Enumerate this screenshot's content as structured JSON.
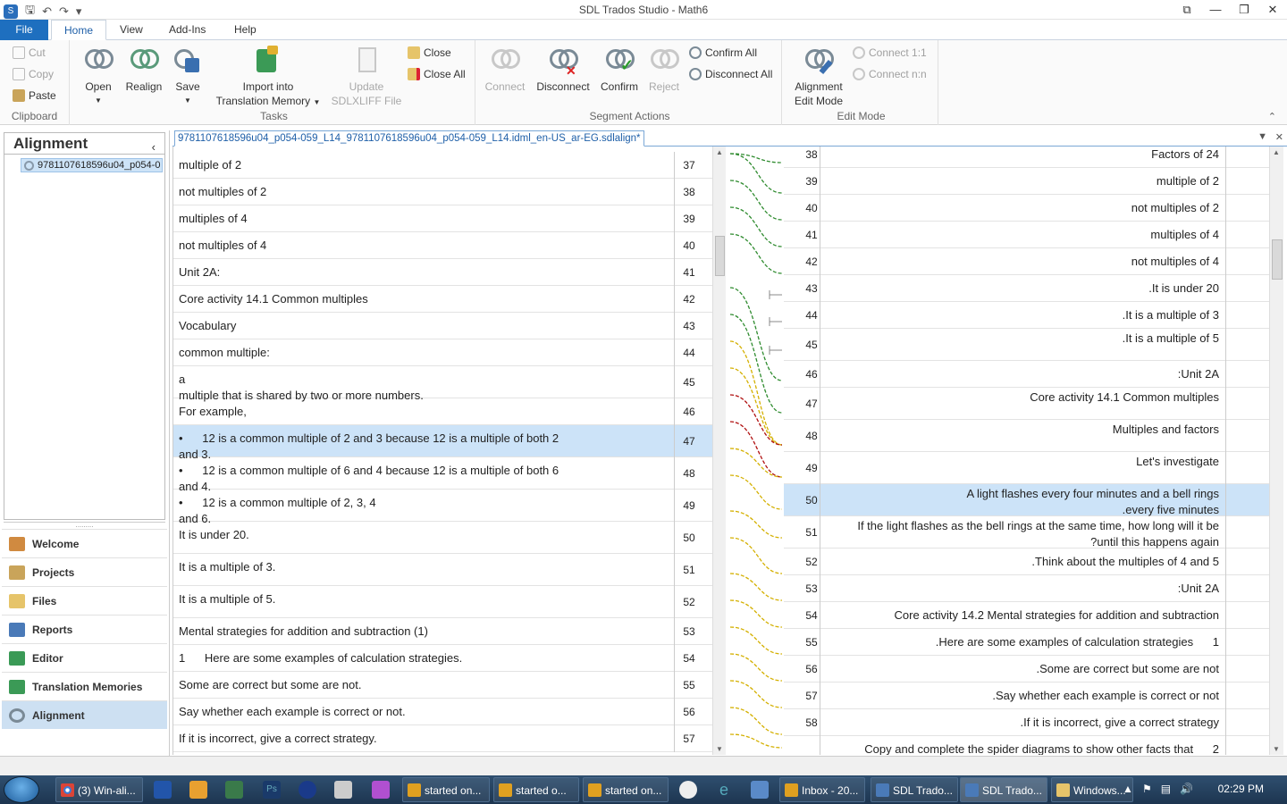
{
  "window": {
    "title": "SDL Trados Studio - Math6"
  },
  "ribbon_tabs": [
    "File",
    "Home",
    "View",
    "Add-Ins",
    "Help"
  ],
  "clipboard": {
    "cut": "Cut",
    "copy": "Copy",
    "paste": "Paste",
    "label": "Clipboard"
  },
  "tasks": {
    "open": "Open",
    "realign": "Realign",
    "save": "Save",
    "import1": "Import into",
    "import2": "Translation Memory",
    "update1": "Update",
    "update2": "SDLXLIFF File",
    "close": "Close",
    "close_all": "Close All",
    "label": "Tasks"
  },
  "segment_actions": {
    "connect": "Connect",
    "disconnect": "Disconnect",
    "confirm": "Confirm",
    "reject": "Reject",
    "confirm_all": "Confirm All",
    "disconnect_all": "Disconnect All",
    "label": "Segment Actions"
  },
  "edit_mode": {
    "alignment1": "Alignment",
    "alignment2": "Edit Mode",
    "connect_11": "Connect 1:1",
    "connect_nn": "Connect n:n",
    "label": "Edit Mode"
  },
  "left_panel": {
    "title": "Alignment",
    "tree_item": "9781107618596u04_p054-0",
    "nav": [
      "Welcome",
      "Projects",
      "Files",
      "Reports",
      "Editor",
      "Translation Memories",
      "Alignment"
    ]
  },
  "document_tab": "9781107618596u04_p054-059_L14_9781107618596u04_p054-059_L14.idml_en-US_ar-EG.sdlalign*",
  "source_segments": [
    {
      "num": "37",
      "text": "multiple of 2"
    },
    {
      "num": "38",
      "text": "not multiples of 2"
    },
    {
      "num": "39",
      "text": "multiples of 4"
    },
    {
      "num": "40",
      "text": "not multiples of 4"
    },
    {
      "num": "41",
      "text": "Unit 2A:"
    },
    {
      "num": "42",
      "text": "Core activity 14.1 Common multiples"
    },
    {
      "num": "43",
      "text": "Vocabulary"
    },
    {
      "num": "44",
      "text": "common multiple:"
    },
    {
      "num": "45",
      "text": "a\nmultiple that is shared by two or more numbers."
    },
    {
      "num": "46",
      "text": "For example,"
    },
    {
      "num": "47",
      "text": "•      12 is a common multiple of 2 and 3 because 12 is a multiple of both 2\nand 3."
    },
    {
      "num": "48",
      "text": "•      12 is a common multiple of 6 and 4 because 12 is a multiple of both 6\nand 4."
    },
    {
      "num": "49",
      "text": "•      12 is a common multiple of 2, 3, 4\nand 6."
    },
    {
      "num": "50",
      "text": "It is under 20."
    },
    {
      "num": "51",
      "text": "It is a multiple of 3."
    },
    {
      "num": "52",
      "text": "It is a multiple of 5."
    },
    {
      "num": "53",
      "text": "Mental strategies for addition and subtraction (1)"
    },
    {
      "num": "54",
      "text": "1      Here are some examples of calculation strategies."
    },
    {
      "num": "55",
      "text": "Some are correct but some are not."
    },
    {
      "num": "56",
      "text": "Say whether each example is correct or not."
    },
    {
      "num": "57",
      "text": "If it is incorrect, give a correct strategy."
    }
  ],
  "target_segments": [
    {
      "num": "38",
      "text": "Factors of 24"
    },
    {
      "num": "39",
      "text": "multiple of 2"
    },
    {
      "num": "40",
      "text": "not multiples of 2"
    },
    {
      "num": "41",
      "text": "multiples of 4"
    },
    {
      "num": "42",
      "text": "not multiples of 4"
    },
    {
      "num": "43",
      "text": ".It is under 20"
    },
    {
      "num": "44",
      "text": ".It is a multiple of 3"
    },
    {
      "num": "45",
      "text": ".It is a multiple of 5"
    },
    {
      "num": "46",
      "text": ":Unit 2A"
    },
    {
      "num": "47",
      "text": "Core activity 14.1 Common multiples"
    },
    {
      "num": "48",
      "text": "Multiples and factors"
    },
    {
      "num": "49",
      "text": "Let's investigate"
    },
    {
      "num": "50",
      "text": "A light flashes every four minutes and a bell rings\n.every five minutes"
    },
    {
      "num": "51",
      "text": "If the light flashes as the bell rings at the same time, how long will it be\n?until this happens again"
    },
    {
      "num": "52",
      "text": ".Think about the multiples of 4 and 5"
    },
    {
      "num": "53",
      "text": ":Unit 2A"
    },
    {
      "num": "54",
      "text": "Core activity 14.2 Mental strategies for addition and subtraction"
    },
    {
      "num": "55",
      "text": ".Here are some examples of calculation strategies      1"
    },
    {
      "num": "56",
      "text": ".Some are correct but some are not"
    },
    {
      "num": "57",
      "text": ".Say whether each example is correct or not"
    },
    {
      "num": "58",
      "text": ".If it is incorrect, give a correct strategy"
    },
    {
      "num": "",
      "text": "Copy and complete the spider diagrams to show other facts that      2"
    }
  ],
  "taskbar": {
    "tasks": [
      "(3) Win-ali...",
      "started on...",
      "started o...",
      "started on...",
      "Inbox - 20...",
      "SDL Trado...",
      "SDL Trado...",
      "Windows..."
    ],
    "clock": "02:29 PM"
  },
  "colors": {
    "accent": "#1e6fbf",
    "selection": "#cce3f8",
    "link_green": "#2e8b2e",
    "link_yellow": "#d4b000",
    "link_red": "#b01010"
  }
}
